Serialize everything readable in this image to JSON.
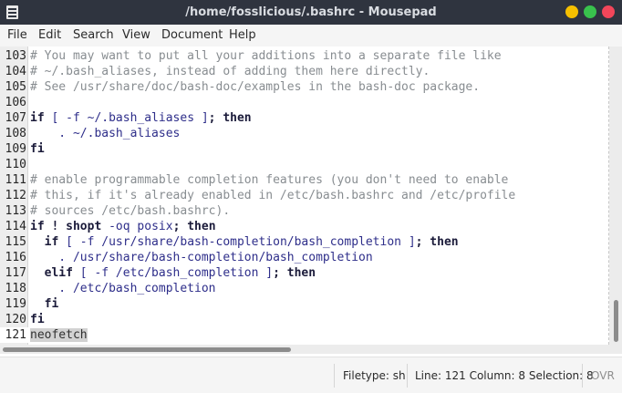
{
  "window": {
    "title": "/home/fosslicious/.bashrc - Mousepad"
  },
  "menubar": {
    "items": [
      "File",
      "Edit",
      "Search",
      "View",
      "Document",
      "Help"
    ]
  },
  "editor": {
    "lines": [
      {
        "number": "103",
        "segments": [
          {
            "t": "cm",
            "v": "# You may want to put all your additions into a separate file like"
          }
        ]
      },
      {
        "number": "104",
        "segments": [
          {
            "t": "cm",
            "v": "# ~/.bash_aliases, instead of adding them here directly."
          }
        ]
      },
      {
        "number": "105",
        "segments": [
          {
            "t": "cm",
            "v": "# See /usr/share/doc/bash-doc/examples in the bash-doc package."
          }
        ]
      },
      {
        "number": "106",
        "segments": []
      },
      {
        "number": "107",
        "segments": [
          {
            "t": "kw",
            "v": "if"
          },
          {
            "t": "id",
            "v": " [ -f ~/.bash_aliases ]"
          },
          {
            "t": "kw",
            "v": "; then"
          }
        ]
      },
      {
        "number": "108",
        "segments": [
          {
            "t": "id",
            "v": "    . ~/.bash_aliases"
          }
        ]
      },
      {
        "number": "109",
        "segments": [
          {
            "t": "kw",
            "v": "fi"
          }
        ]
      },
      {
        "number": "110",
        "segments": []
      },
      {
        "number": "111",
        "segments": [
          {
            "t": "cm",
            "v": "# enable programmable completion features (you don't need to enable"
          }
        ]
      },
      {
        "number": "112",
        "segments": [
          {
            "t": "cm",
            "v": "# this, if it's already enabled in /etc/bash.bashrc and /etc/profile"
          }
        ]
      },
      {
        "number": "113",
        "segments": [
          {
            "t": "cm",
            "v": "# sources /etc/bash.bashrc)."
          }
        ]
      },
      {
        "number": "114",
        "segments": [
          {
            "t": "kw",
            "v": "if ! shopt"
          },
          {
            "t": "id",
            "v": " -oq posix"
          },
          {
            "t": "kw",
            "v": "; then"
          }
        ]
      },
      {
        "number": "115",
        "segments": [
          {
            "t": "kw",
            "v": "  if"
          },
          {
            "t": "id",
            "v": " [ -f /usr/share/bash-completion/bash_completion ]"
          },
          {
            "t": "kw",
            "v": "; then"
          }
        ]
      },
      {
        "number": "116",
        "segments": [
          {
            "t": "id",
            "v": "    . /usr/share/bash-completion/bash_completion"
          }
        ]
      },
      {
        "number": "117",
        "segments": [
          {
            "t": "kw",
            "v": "  elif"
          },
          {
            "t": "id",
            "v": " [ -f /etc/bash_completion ]"
          },
          {
            "t": "kw",
            "v": "; then"
          }
        ]
      },
      {
        "number": "118",
        "segments": [
          {
            "t": "id",
            "v": "    . /etc/bash_completion"
          }
        ]
      },
      {
        "number": "119",
        "segments": [
          {
            "t": "kw",
            "v": "  fi"
          }
        ]
      },
      {
        "number": "120",
        "segments": [
          {
            "t": "kw",
            "v": "fi"
          }
        ]
      },
      {
        "number": "121",
        "segments": [
          {
            "t": "hl",
            "v": "neofetch"
          }
        ],
        "current": true
      }
    ]
  },
  "statusbar": {
    "filetype": "Filetype: sh",
    "position": "Line: 121 Column: 8 Selection: 8",
    "mode": "OVR"
  },
  "colors": {
    "titlebar_bg": "#2f343f",
    "minimize": "#f6c000",
    "maximize": "#39c24d",
    "close": "#f2465a",
    "comment": "#888d91",
    "keyword": "#1b1b3a",
    "identifier": "#2e2e8a",
    "selection": "#d2d2d2"
  },
  "icons": {
    "app": "mousepad-icon",
    "minimize": "minimize-button-icon",
    "maximize": "maximize-button-icon",
    "close": "close-button-icon"
  }
}
